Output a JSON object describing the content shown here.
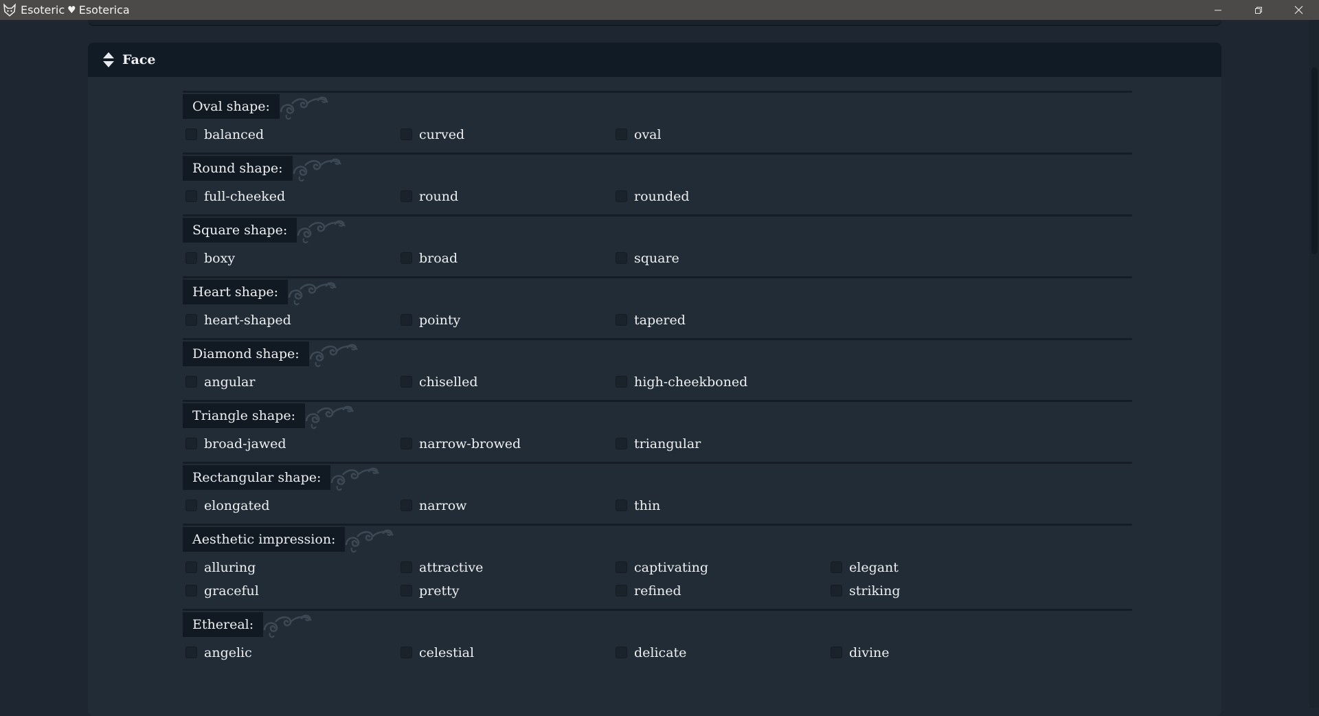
{
  "window": {
    "title_left": "Esoteric",
    "title_heart": "♥",
    "title_right": "Esoterica",
    "controls": [
      "minimize-icon",
      "restore-icon",
      "close-icon"
    ]
  },
  "panel": {
    "title": "Face"
  },
  "groups": [
    {
      "label": "Oval shape:",
      "options": [
        "balanced",
        "curved",
        "oval"
      ]
    },
    {
      "label": "Round shape:",
      "options": [
        "full-cheeked",
        "round",
        "rounded"
      ]
    },
    {
      "label": "Square shape:",
      "options": [
        "boxy",
        "broad",
        "square"
      ]
    },
    {
      "label": "Heart shape:",
      "options": [
        "heart-shaped",
        "pointy",
        "tapered"
      ]
    },
    {
      "label": "Diamond shape:",
      "options": [
        "angular",
        "chiselled",
        "high-cheekboned"
      ]
    },
    {
      "label": "Triangle shape:",
      "options": [
        "broad-jawed",
        "narrow-browed",
        "triangular"
      ]
    },
    {
      "label": "Rectangular shape:",
      "options": [
        "elongated",
        "narrow",
        "thin"
      ]
    },
    {
      "label": "Aesthetic impression:",
      "options": [
        "alluring",
        "attractive",
        "captivating",
        "elegant",
        "graceful",
        "pretty",
        "refined",
        "striking"
      ]
    },
    {
      "label": "Ethereal:",
      "options": [
        "angelic",
        "celestial",
        "delicate",
        "divine"
      ]
    }
  ],
  "colors": {
    "background": "#1e2731",
    "panel": "#222c36",
    "header": "#111b25",
    "titlebar": "#4b4a48"
  }
}
